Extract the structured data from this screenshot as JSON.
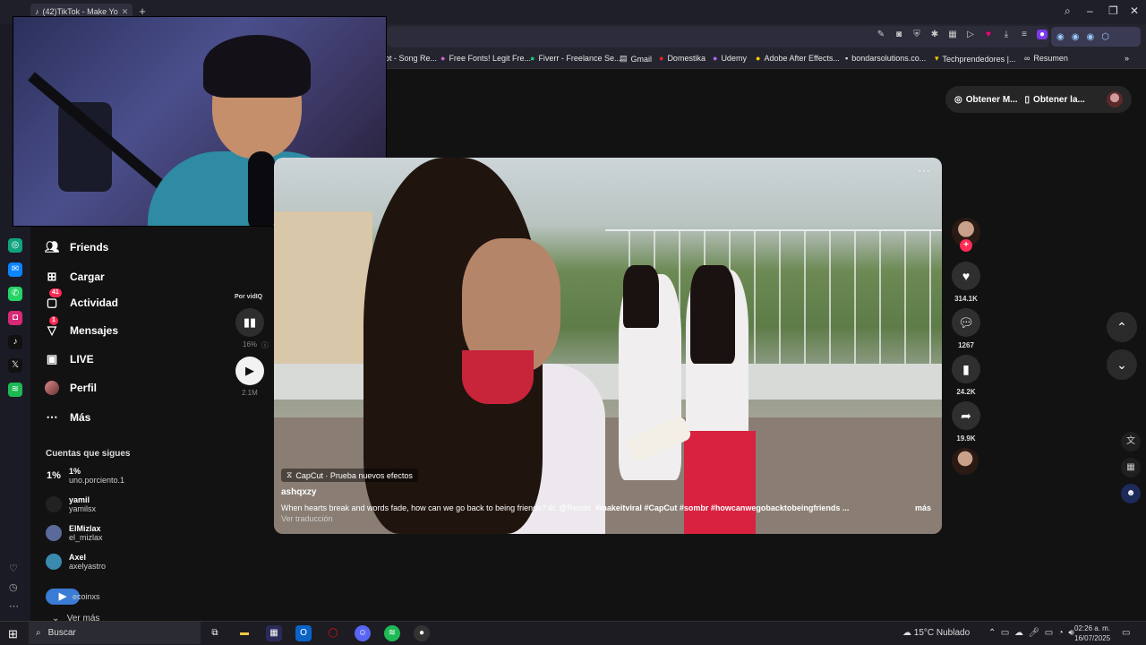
{
  "browser": {
    "tab_title": "(42)TikTok - Make Yo",
    "bookmarks": [
      "ot - Song Re...",
      "Free Fonts! Legit Fre...",
      "Fiverr - Freelance Se...",
      "Gmail",
      "Domestika",
      "Udemy",
      "Adobe After Effects...",
      "bondarsolutions.co...",
      "Techprendedores |...",
      "Resumen"
    ]
  },
  "header": {
    "btn_coins": "Obtener M...",
    "btn_app": "Obtener la..."
  },
  "nav": {
    "friends": "Friends",
    "upload": "Cargar",
    "activity": "Actividad",
    "activity_badge": "41",
    "messages": "Mensajes",
    "messages_badge": "1",
    "live": "LIVE",
    "profile": "Perfil",
    "more": "Más"
  },
  "following": {
    "title": "Cuentas que sigues",
    "accounts": [
      {
        "name": "1%",
        "handle": "uno.porciento.1",
        "avatar": "1%"
      },
      {
        "name": "yamil",
        "handle": "yamilsx",
        "avatar": ""
      },
      {
        "name": "ElMizlax",
        "handle": "el_mizlax",
        "avatar": ""
      },
      {
        "name": "Axel",
        "handle": "axelyastro",
        "avatar": ""
      },
      {
        "name": "",
        "handle": "ecoinxs",
        "avatar": ""
      }
    ],
    "see_more": "Ver más"
  },
  "vidiq": {
    "label": "Por vidIQ",
    "percent": "16%",
    "views": "2.1M"
  },
  "video": {
    "effect": "CapCut · Prueba nuevos efectos",
    "author": "ashqxzy",
    "caption_text": "When hearts break and words fade, how can we go back to being friends? ib: @Rendo",
    "hashtags": "#makeitviral  #CapCut  #sombr  #howcanwegobacktobeingfriends ...",
    "more": "más",
    "translate": "Ver traducción"
  },
  "actions": {
    "likes": "314.1K",
    "comments": "1267",
    "saves": "24.2K",
    "shares": "19.9K"
  },
  "taskbar": {
    "search": "Buscar",
    "weather": "15°C  Nublado",
    "time": "02:26 a. m.",
    "date": "16/07/2025"
  },
  "colors": {
    "accent": "#fe2c55",
    "background": "#121212"
  }
}
